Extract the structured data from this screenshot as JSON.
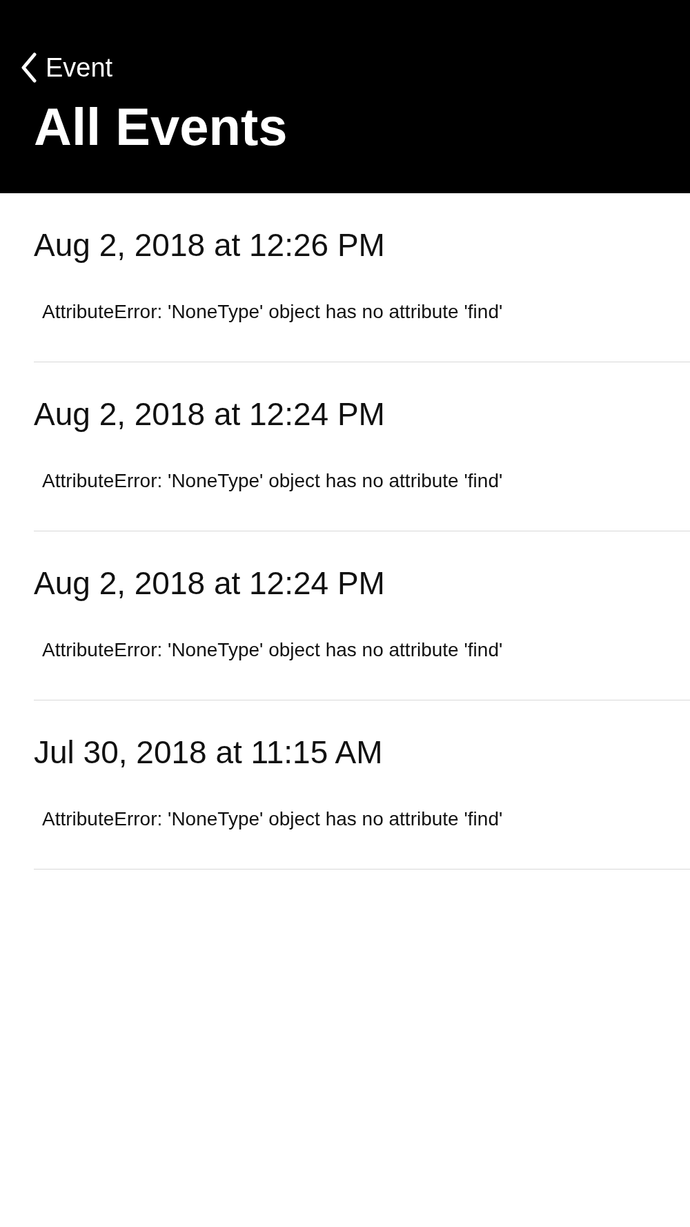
{
  "nav_bar": {
    "back_label": "Event",
    "title": "All Events"
  },
  "events": [
    {
      "date": "Aug 2, 2018 at 12:26 PM",
      "message": "AttributeError: 'NoneType' object has no attribute 'find'"
    },
    {
      "date": "Aug 2, 2018 at 12:24 PM",
      "message": "AttributeError: 'NoneType' object has no attribute 'find'"
    },
    {
      "date": "Aug 2, 2018 at 12:24 PM",
      "message": "AttributeError: 'NoneType' object has no attribute 'find'"
    },
    {
      "date": "Jul 30, 2018 at 11:15 AM",
      "message": "AttributeError: 'NoneType' object has no attribute 'find'"
    }
  ]
}
